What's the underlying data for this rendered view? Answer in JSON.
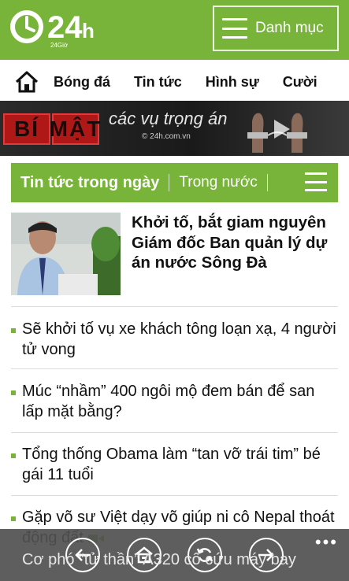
{
  "header": {
    "logo_text": "24",
    "logo_h": "h",
    "logo_sub": "24Giờ",
    "menu_label": "Danh mục",
    "bg_color": "#78b43a"
  },
  "nav": {
    "home_icon": "home-icon",
    "items": [
      "Bóng đá",
      "Tin tức",
      "Hình sự",
      "Cười"
    ]
  },
  "banner": {
    "chars": [
      "BÍ",
      "MẬT"
    ],
    "title": "các vụ trọng án",
    "subtitle": "© 24h.com.vn"
  },
  "section": {
    "title": "Tin tức trong ngày",
    "sub": "Trong nước"
  },
  "featured": {
    "headline": "Khởi tố, bắt giam nguyên Giám đốc Ban quản lý dự án nước Sông Đà"
  },
  "news": [
    {
      "text": "Sẽ khởi tố vụ xe khách tông loạn xạ, 4 người tử vong"
    },
    {
      "text": "Múc “nhầm” 400 ngôi mộ đem bán để san lấp mặt bằng?"
    },
    {
      "text": "Tổng thống Obama làm “tan vỡ trái tim” bé gái 11 tuổi"
    },
    {
      "text": "Gặp võ sư Việt dạy võ giúp ni cô Nepal thoát động đất"
    }
  ],
  "peek": "Cơ phó “tử thần” A320 cố cứu máy bay",
  "appbar": {
    "buttons": [
      "back-icon",
      "home-page-icon",
      "refresh-icon",
      "forward-icon"
    ],
    "more": "•••"
  }
}
